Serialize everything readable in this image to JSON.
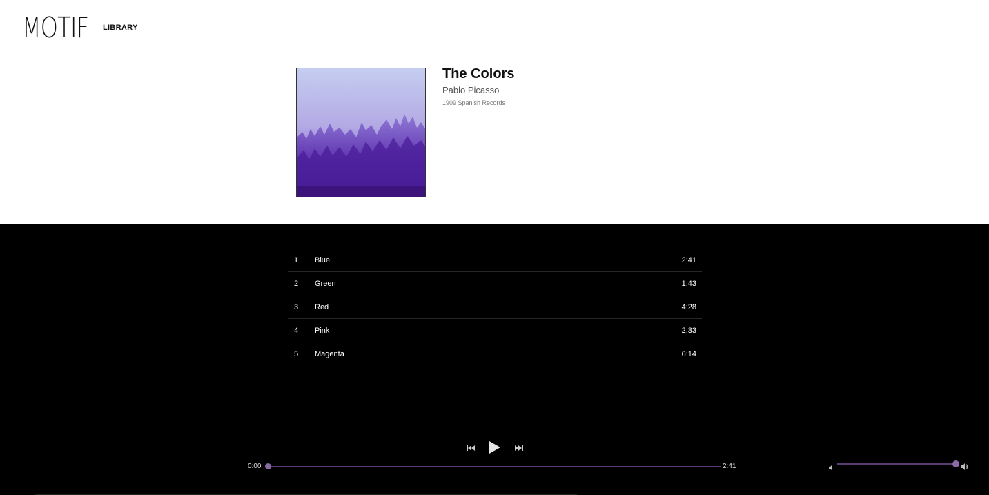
{
  "header": {
    "logo": "MOTIF",
    "nav_library": "LIBRARY"
  },
  "album": {
    "title": "The Colors",
    "artist": "Pablo Picasso",
    "meta": "1909 Spanish Records",
    "cover_icon": "misty-forest-artwork"
  },
  "tracks": [
    {
      "number": "1",
      "name": "Blue",
      "duration": "2:41"
    },
    {
      "number": "2",
      "name": "Green",
      "duration": "1:43"
    },
    {
      "number": "3",
      "name": "Red",
      "duration": "4:28"
    },
    {
      "number": "4",
      "name": "Pink",
      "duration": "2:33"
    },
    {
      "number": "5",
      "name": "Magenta",
      "duration": "6:14"
    }
  ],
  "player": {
    "current_time": "0:00",
    "total_time": "2:41",
    "progress": 0,
    "volume": 1.0,
    "icons": {
      "prev": "skip-back-icon",
      "play": "play-icon",
      "next": "skip-forward-icon",
      "volume_low": "volume-low-icon",
      "volume_high": "volume-high-icon"
    }
  },
  "colors": {
    "accent": "#8a6aa6",
    "track_bar": "#5a3c72",
    "dark_bg": "#000000"
  }
}
